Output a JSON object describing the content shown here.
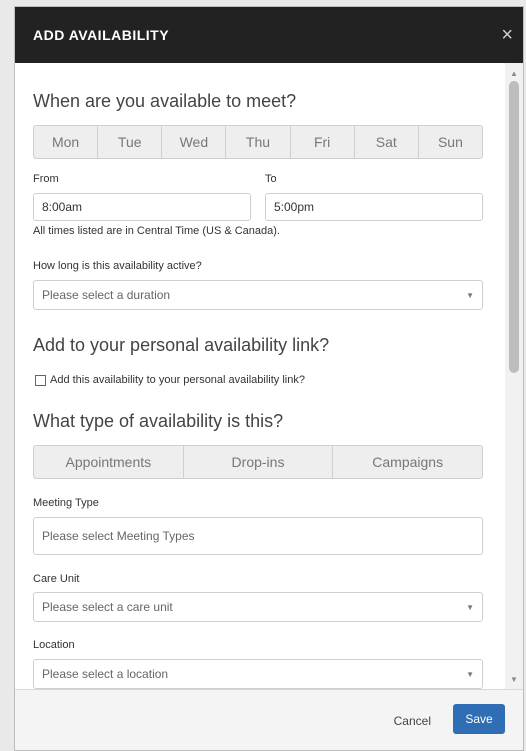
{
  "modal": {
    "title": "ADD AVAILABILITY",
    "close_icon": "×"
  },
  "sections": {
    "availability_heading": "When are you available to meet?",
    "days": [
      "Mon",
      "Tue",
      "Wed",
      "Thu",
      "Fri",
      "Sat",
      "Sun"
    ],
    "from_label": "From",
    "to_label": "To",
    "from_value": "8:00am",
    "to_value": "5:00pm",
    "timezone_note": "All times listed are in Central Time (US & Canada).",
    "duration_label": "How long is this availability active?",
    "duration_placeholder": "Please select a duration",
    "personal_link_heading": "Add to your personal availability link?",
    "personal_link_checkbox": "Add this availability to your personal availability link?",
    "type_heading": "What type of availability is this?",
    "availability_types": [
      "Appointments",
      "Drop-ins",
      "Campaigns"
    ],
    "meeting_type_label": "Meeting Type",
    "meeting_type_placeholder": "Please select Meeting Types",
    "care_unit_label": "Care Unit",
    "care_unit_placeholder": "Please select a care unit",
    "location_label": "Location",
    "location_placeholder": "Please select a location"
  },
  "footer": {
    "cancel_label": "Cancel",
    "save_label": "Save"
  },
  "colors": {
    "header_bg": "#222222",
    "primary": "#2f6db5"
  }
}
